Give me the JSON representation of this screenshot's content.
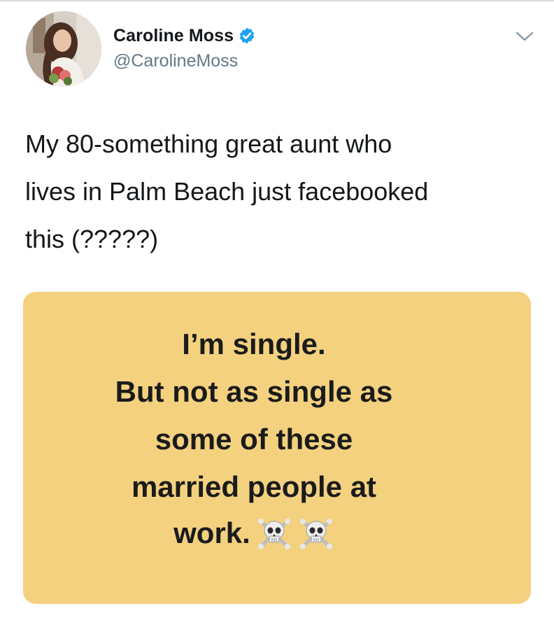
{
  "tweet": {
    "author": {
      "display_name": "Caroline Moss",
      "handle": "@CarolineMoss",
      "verified": true,
      "avatar_icon": "profile-photo"
    },
    "menu_icon": "chevron-down-icon",
    "text": "My 80-something great aunt who\nlives in Palm Beach just facebooked\nthis (?????)",
    "media": {
      "background_color": "#f3d17f",
      "lines": [
        "I’m single.",
        "But not as single as",
        "some of these",
        "married people at",
        "work."
      ],
      "emoji": [
        "skull-and-crossbones-icon",
        "skull-and-crossbones-icon"
      ]
    }
  },
  "colors": {
    "text_primary": "#14171a",
    "text_secondary": "#657786",
    "verified_blue": "#1da1f2",
    "card_yellow": "#f3d17f"
  }
}
